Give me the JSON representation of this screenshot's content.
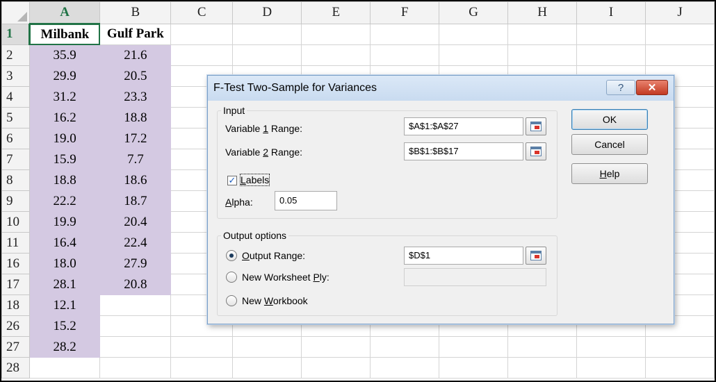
{
  "sheet": {
    "columns": [
      "A",
      "B",
      "C",
      "D",
      "E",
      "F",
      "G",
      "H",
      "I",
      "J"
    ],
    "rows": [
      {
        "n": "1",
        "a": "Milbank",
        "b": "Gulf Park"
      },
      {
        "n": "2",
        "a": "35.9",
        "b": "21.6"
      },
      {
        "n": "3",
        "a": "29.9",
        "b": "20.5"
      },
      {
        "n": "4",
        "a": "31.2",
        "b": "23.3"
      },
      {
        "n": "5",
        "a": "16.2",
        "b": "18.8"
      },
      {
        "n": "6",
        "a": "19.0",
        "b": "17.2"
      },
      {
        "n": "7",
        "a": "15.9",
        "b": "7.7"
      },
      {
        "n": "8",
        "a": "18.8",
        "b": "18.6"
      },
      {
        "n": "9",
        "a": "22.2",
        "b": "18.7"
      },
      {
        "n": "10",
        "a": "19.9",
        "b": "20.4"
      },
      {
        "n": "11",
        "a": "16.4",
        "b": "22.4"
      },
      {
        "n": "16",
        "a": "18.0",
        "b": "27.9"
      },
      {
        "n": "17",
        "a": "28.1",
        "b": "20.8"
      },
      {
        "n": "18",
        "a": "12.1",
        "b": ""
      },
      {
        "n": "26",
        "a": "15.2",
        "b": ""
      },
      {
        "n": "27",
        "a": "28.2",
        "b": ""
      },
      {
        "n": "28",
        "a": "",
        "b": ""
      }
    ],
    "shade_color": "#d4c9e2",
    "accent_color": "#217346"
  },
  "dialog": {
    "title": "F-Test Two-Sample for Variances",
    "help_glyph": "?",
    "close_glyph": "✕",
    "input_legend": "Input",
    "var1_label_pre": "Variable ",
    "var1_label_key": "1",
    "var1_label_post": " Range:",
    "var1_value": "$A$1:$A$27",
    "var2_label_pre": "Variable ",
    "var2_label_key": "2",
    "var2_label_post": " Range:",
    "var2_value": "$B$1:$B$17",
    "labels_key": "L",
    "labels_rest": "abels",
    "labels_checked_glyph": "✓",
    "alpha_key": "A",
    "alpha_rest": "lpha:",
    "alpha_value": "0.05",
    "output_legend": "Output options",
    "output_range_key": "O",
    "output_range_rest": "utput Range:",
    "output_range_value": "$D$1",
    "new_ply_pre": "New Worksheet ",
    "new_ply_key": "P",
    "new_ply_post": "ly:",
    "new_wb_pre": "New ",
    "new_wb_key": "W",
    "new_wb_post": "orkbook",
    "ok_label": "OK",
    "cancel_label": "Cancel",
    "help_key": "H",
    "help_rest": "elp"
  }
}
